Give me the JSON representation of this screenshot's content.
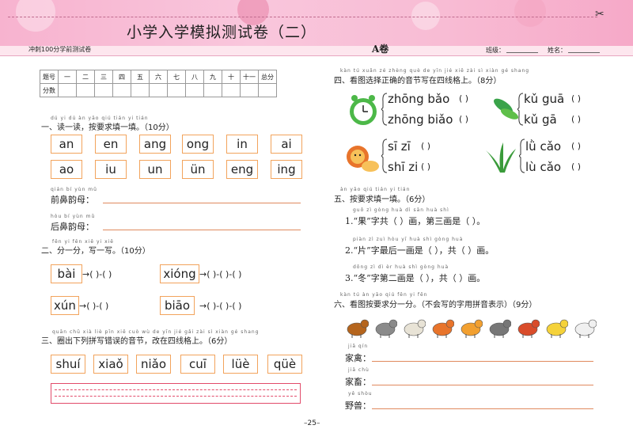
{
  "header": {
    "title": "小学入学模拟测试卷（二）",
    "subtitle": "冲刺100分学前测试卷",
    "volume": "A卷",
    "class_label": "班级：",
    "name_label": "姓名：",
    "page_number": "–25–"
  },
  "score_table": {
    "header_row": [
      "题号",
      "一",
      "二",
      "三",
      "四",
      "五",
      "六",
      "七",
      "八",
      "九",
      "十",
      "十一",
      "总分"
    ],
    "score_label": "分数"
  },
  "section1": {
    "pinyin": "dú yi dú   àn yāo qiú tián yi tián",
    "title": "一、读一读，按要求填一填。（10分）",
    "row1": [
      "an",
      "en",
      "ang",
      "ong",
      "in",
      "ai"
    ],
    "row2": [
      "ao",
      "iu",
      "un",
      "ün",
      "eng",
      "ing"
    ],
    "front_pinyin": "qián bí yùn mǔ",
    "front_label": "前鼻韵母：",
    "back_pinyin": "hòu bí yùn mǔ",
    "back_label": "后鼻韵母："
  },
  "section2": {
    "pinyin": "fēn yi fēn   xiě yi xiě",
    "title": "二、分一分，写一写。（10分）",
    "items": [
      "bài",
      "xióng",
      "xún",
      "biāo"
    ],
    "blank": "→(   )-(   )",
    "blank3": "→(   )-(   )-(   )"
  },
  "section3": {
    "pinyin": "quān chū xià liè pīn xiě cuò wù de yīn jié   gǎi zài sì xiàn gé shang",
    "title": "三、圈出下列拼写错误的音节，改在四线格上。（6分）",
    "items": [
      "shuí",
      "xiaǒ",
      "niǎo",
      "cuī",
      "lüè",
      "qüè"
    ]
  },
  "section4": {
    "pinyin": "kàn tú xuǎn zé zhèng què de yīn jié xiě zài sì xiàn gé shang",
    "title": "四、看图选择正确的音节写在四线格上。（8分）",
    "clock": [
      "zhōng bǎo",
      "zhōng biǎo"
    ],
    "cucumber": [
      "kǔ guā",
      "kǔ gā"
    ],
    "lion": [
      "sī zī",
      "shī zi"
    ],
    "grass": [
      "lǜ cǎo",
      "lù cǎo"
    ],
    "paren": "(   )"
  },
  "section5": {
    "pinyin": "àn yāo qiú tián yi tián",
    "title": "五、按要求填一填。（6分）",
    "q1": "1.“果”字共（     ）画，第三画是（     ）。",
    "q1_py": "guǒ   zì gòng   huà   dì sān huà shì",
    "q2": "2.“片”字最后一画是（     ），共（     ）画。",
    "q2_py": "piàn   zì zuì hòu yī huà shì   gòng   huà",
    "q3": "3.“冬”字第二画是（     ），共（     ）画。",
    "q3_py": "dōng   zì dì èr huà shì   gòng   huà"
  },
  "section6": {
    "pinyin": "kàn tú àn yāo qiú fēn yi fēn",
    "title": "六、看图按要求分一分。（不会写的字用拼音表示）（9分）",
    "animals": [
      "horse",
      "cow",
      "sheep",
      "lion",
      "tiger",
      "zebra",
      "rooster",
      "duck",
      "goose"
    ],
    "poultry_py": "jiā qín",
    "poultry": "家禽：",
    "livestock_py": "jiā chù",
    "livestock": "家畜：",
    "wild_py": "yě shòu",
    "wild": "野兽："
  },
  "colors": {
    "header_pink": "#f8bcd4",
    "box_border": "#f2a35c",
    "arrow_green": "#2ea24f",
    "band_red": "#e24b6a"
  }
}
